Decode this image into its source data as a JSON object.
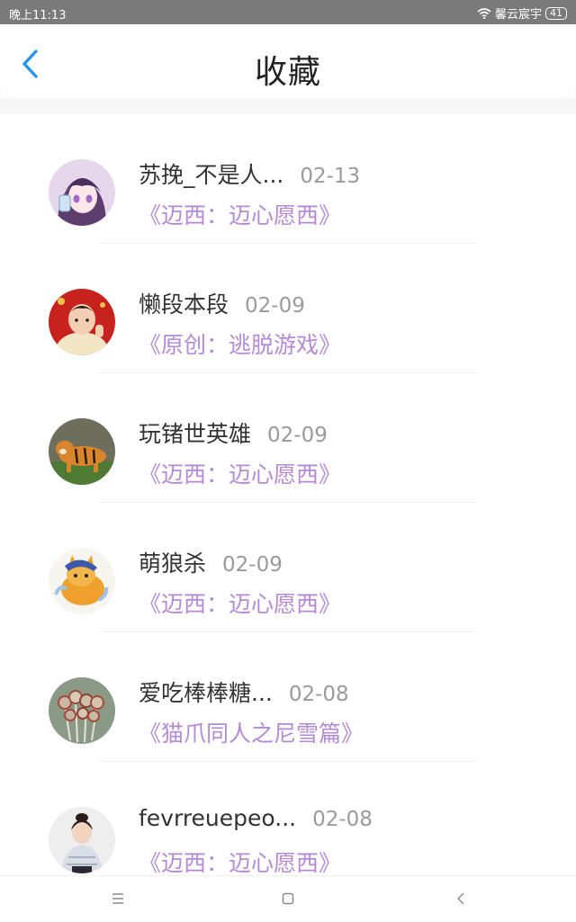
{
  "status_bar": {
    "time": "晚上11:13",
    "carrier": "馨云宸宇",
    "battery": "41"
  },
  "header": {
    "title": "收藏",
    "back_icon": "chevron-left-icon",
    "accent_color": "#2196f3"
  },
  "items": [
    {
      "author": "苏挽_不是人...",
      "date": "02-13",
      "title": "《迈西：迈心愿西》"
    },
    {
      "author": "懒段本段",
      "date": "02-09",
      "title": "《原创：逃脱游戏》"
    },
    {
      "author": "玩锗世英雄",
      "date": "02-09",
      "title": "《迈西：迈心愿西》"
    },
    {
      "author": "萌狼杀",
      "date": "02-09",
      "title": "《迈西：迈心愿西》"
    },
    {
      "author": "爱吃棒棒糖...",
      "date": "02-08",
      "title": "《猫爪同人之尼雪篇》"
    },
    {
      "author": "fevrreuepeo...",
      "date": "02-08",
      "title": "《迈西：迈心愿西》"
    }
  ],
  "nav_bar": {
    "menu_icon": "menu-icon",
    "home_icon": "home-icon",
    "back_icon": "back-icon"
  }
}
